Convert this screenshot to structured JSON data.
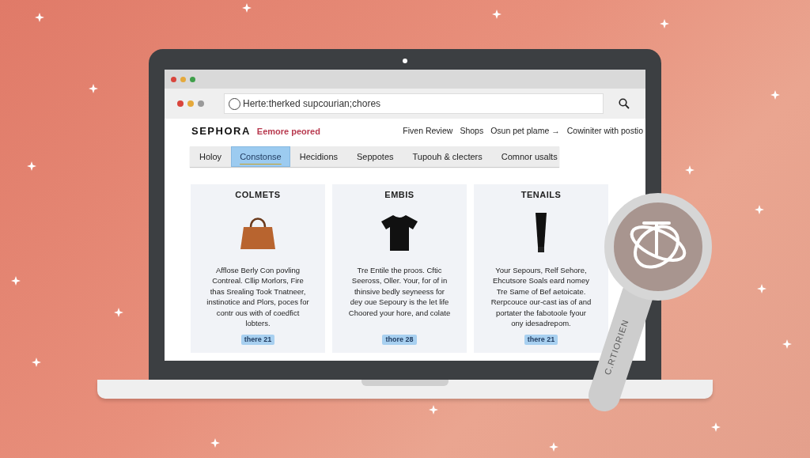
{
  "browser": {
    "address": "Herte:therked supcourian;chores"
  },
  "site": {
    "logo": "SEPHORA",
    "tagline": "Eemore peored",
    "nav": [
      "Fiven Review",
      "Shops",
      "Osun pet plame →",
      "Cowiniter with postio"
    ]
  },
  "tabs": [
    {
      "label": "Holoy",
      "selected": false
    },
    {
      "label": "Constonse",
      "selected": true
    },
    {
      "label": "Hecidions",
      "selected": false
    },
    {
      "label": "Seppotes",
      "selected": false
    },
    {
      "label": "Tupouh & clecters",
      "selected": false
    },
    {
      "label": "Comnor usalts",
      "selected": false
    }
  ],
  "cards": [
    {
      "title": "COLMETS",
      "kind": "bag",
      "text": "Afflose Berly Con povling\nContreal. Cllip Morlors, Fire\nthas Srealing Took Tnatneer,\ninstinotice and Plors, poces for\ncontr ous with of coedfict\nlobters.",
      "badge": "there 21"
    },
    {
      "title": "EMBIS",
      "kind": "shirt",
      "text": "Tre Entile the proos. Cftic\nSeeross, Oller. Your, for of in\nthinsive bedly seyneess for\ndey oue Sepoury is the let life\nChoored your hore, and colate",
      "badge": "thore 28"
    },
    {
      "title": "TENAILS",
      "kind": "tube",
      "text": "Your Sepours, Relf Sehore,\nEhcutsore Soals eard nomey\nTre Same of Bef aetoicate.\nRerpcouce our-cast ias of and\nportater the fabotoole fyour\nony idesadrepom.",
      "badge": "there 21"
    }
  ],
  "magnifier": {
    "handle_text": "C.RTIORIEN"
  }
}
